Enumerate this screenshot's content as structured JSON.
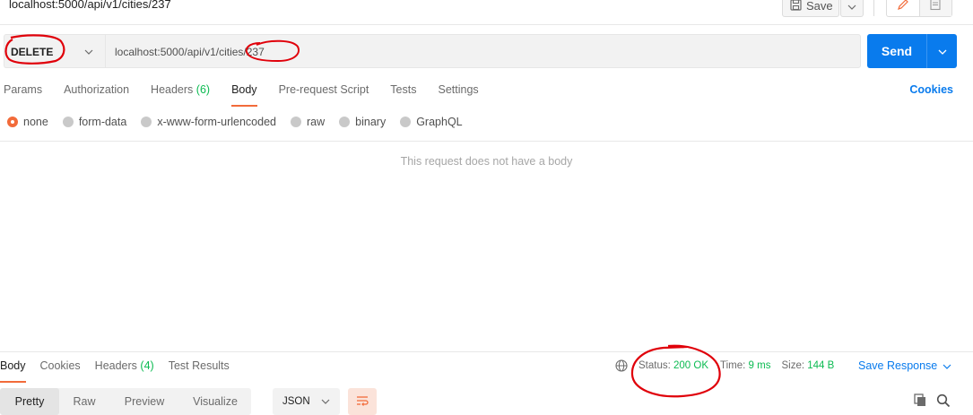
{
  "title": {
    "text": "localhost:5000/api/v1/cities/237"
  },
  "toolbar": {
    "save_label": "Save"
  },
  "request": {
    "method": "DELETE",
    "url": "localhost:5000/api/v1/cities/237",
    "send_label": "Send"
  },
  "request_tabs": [
    {
      "label": "Params"
    },
    {
      "label": "Authorization"
    },
    {
      "label": "Headers",
      "count": "(6)"
    },
    {
      "label": "Body",
      "active": true
    },
    {
      "label": "Pre-request Script"
    },
    {
      "label": "Tests"
    },
    {
      "label": "Settings"
    }
  ],
  "cookies_label": "Cookies",
  "body_types": [
    {
      "label": "none",
      "selected": true
    },
    {
      "label": "form-data"
    },
    {
      "label": "x-www-form-urlencoded"
    },
    {
      "label": "raw"
    },
    {
      "label": "binary"
    },
    {
      "label": "GraphQL"
    }
  ],
  "body_empty_message": "This request does not have a body",
  "response": {
    "tabs": [
      {
        "label": "Body",
        "active": true
      },
      {
        "label": "Cookies"
      },
      {
        "label": "Headers",
        "count": "(4)"
      },
      {
        "label": "Test Results"
      }
    ],
    "status_label": "Status:",
    "status_value": "200 OK",
    "time_label": "Time:",
    "time_value": "9 ms",
    "size_label": "Size:",
    "size_value": "144 B",
    "save_response_label": "Save Response",
    "view_modes": [
      {
        "label": "Pretty",
        "active": true
      },
      {
        "label": "Raw"
      },
      {
        "label": "Preview"
      },
      {
        "label": "Visualize"
      }
    ],
    "format": "JSON"
  },
  "colors": {
    "accent_orange": "#f26b3a",
    "send_blue": "#097bed",
    "status_green": "#0cbb52",
    "annotation_red": "#e0000a"
  }
}
